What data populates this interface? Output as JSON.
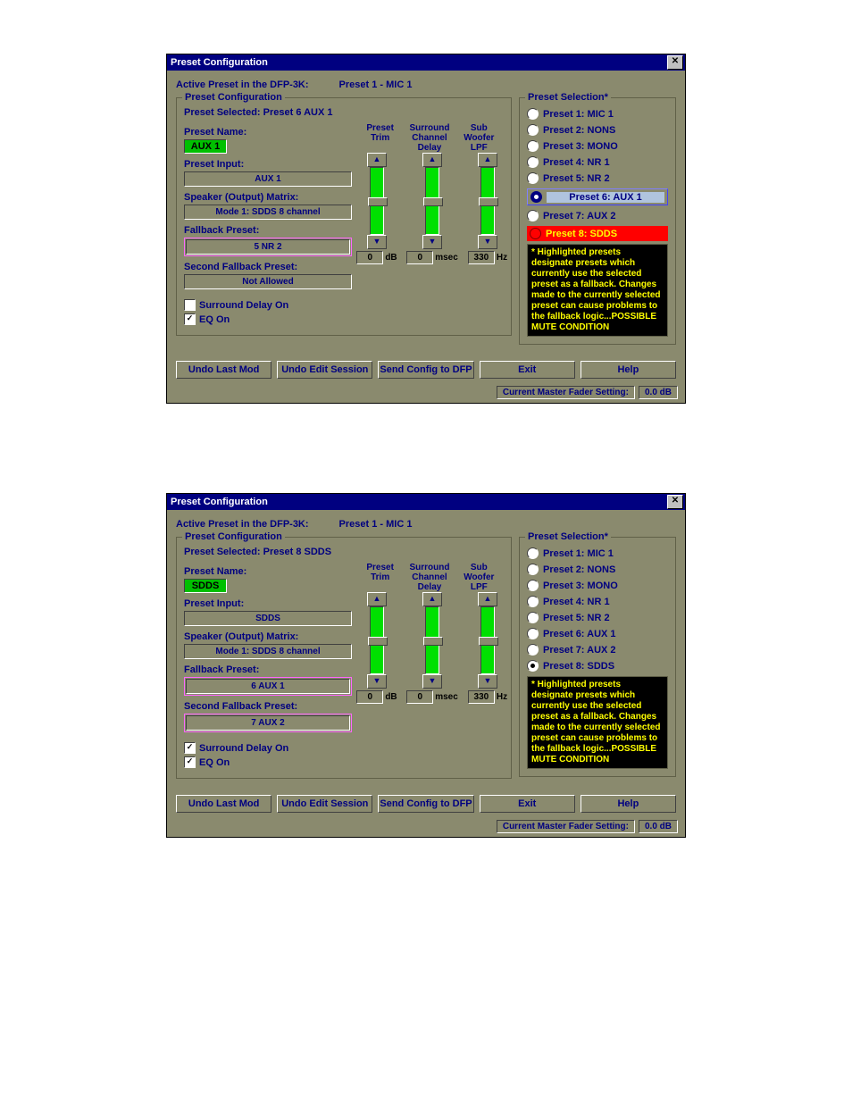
{
  "windows": [
    {
      "title": "Preset Configuration",
      "active_label": "Active Preset in the DFP-3K:",
      "active_value": "Preset 1 -  MIC 1",
      "config": {
        "legend": "Preset Configuration",
        "selected": "Preset Selected: Preset 6 AUX 1",
        "name_label": "Preset Name:",
        "name": "AUX 1",
        "input_label": "Preset Input:",
        "input": "AUX 1",
        "col_preset": "Preset",
        "col_trim": "Trim",
        "col_surr1": "Surround",
        "col_surr2": "Channel",
        "col_surr3": "Delay",
        "col_sub1": "Sub",
        "col_sub2": "Woofer",
        "col_sub3": "LPF",
        "matrix_label": "Speaker (Output) Matrix:",
        "matrix": "Mode 1: SDDS 8 channel",
        "fb_label": "Fallback  Preset:",
        "fb": "5  NR 2",
        "fb_hl": true,
        "fb2_label": "Second Fallback Preset:",
        "fb2": "Not Allowed",
        "fb2_hl": false,
        "chk1": "Surround Delay On",
        "chk1v": false,
        "chk2": "EQ On",
        "chk2v": true,
        "s1": {
          "val": "0",
          "unit": "dB",
          "arrow": "up",
          "thumb": "mid"
        },
        "s2": {
          "val": "0",
          "unit": "msec",
          "arrow": "up",
          "thumb": "mid"
        },
        "s3": {
          "val": "330",
          "unit": "Hz",
          "arrow": "up",
          "thumb": "mid"
        }
      },
      "selection": {
        "legend": "Preset Selection*",
        "items": [
          {
            "label": "Preset 1: MIC 1",
            "state": "n"
          },
          {
            "label": "Preset 2:   NONS",
            "state": "n"
          },
          {
            "label": "Preset 3:   MONO",
            "state": "n"
          },
          {
            "label": "Preset 4:   NR 1",
            "state": "n"
          },
          {
            "label": "Preset 5:   NR 2",
            "state": "n"
          },
          {
            "label": "Preset 6: AUX 1",
            "state": "hl"
          },
          {
            "label": "Preset 7:   AUX 2",
            "state": "n"
          },
          {
            "label": "Preset 8:   SDDS",
            "state": "alert"
          }
        ],
        "warn": "* Highlighted presets designate presets which currently use the selected preset as a fallback.  Changes made to the currently selected preset can cause problems to the fallback logic...POSSIBLE MUTE CONDITION"
      },
      "buttons": [
        "Undo Last Mod",
        "Undo Edit Session",
        "Send Config to DFP",
        "Exit",
        "Help"
      ],
      "status_label": "Current Master Fader Setting:",
      "status_value": "0.0   dB"
    },
    {
      "title": "Preset Configuration",
      "active_label": "Active Preset in the DFP-3K:",
      "active_value": "Preset 1 - MIC 1",
      "config": {
        "legend": "Preset Configuration",
        "selected": "Preset Selected: Preset 8 SDDS",
        "name_label": "Preset Name:",
        "name": "SDDS",
        "input_label": "Preset Input:",
        "input": "SDDS",
        "col_preset": "Preset",
        "col_trim": "Trim",
        "col_surr1": "Surround",
        "col_surr2": "Channel",
        "col_surr3": "Delay",
        "col_sub1": "Sub",
        "col_sub2": "Woofer",
        "col_sub3": "LPF",
        "matrix_label": "Speaker (Output) Matrix:",
        "matrix": "Mode 1: SDDS 8 channel",
        "fb_label": "Fallback  Preset:",
        "fb": "6 AUX 1",
        "fb_hl": true,
        "fb2_label": "Second Fallback Preset:",
        "fb2": "7   AUX 2",
        "fb2_hl": true,
        "chk1": "Surround Delay On",
        "chk1v": true,
        "chk2": "EQ On",
        "chk2v": true,
        "s1": {
          "val": "0",
          "unit": "dB",
          "arrow": "up",
          "thumb": "mid"
        },
        "s2": {
          "val": "0",
          "unit": "msec",
          "arrow": "up",
          "thumb": "mid"
        },
        "s3": {
          "val": "330",
          "unit": "Hz",
          "arrow": "up",
          "thumb": "mid"
        }
      },
      "selection": {
        "legend": "Preset Selection*",
        "items": [
          {
            "label": "Preset 1: MIC 1",
            "state": "n"
          },
          {
            "label": "Preset 2:   NONS",
            "state": "n"
          },
          {
            "label": "Preset 3:   MONO",
            "state": "n"
          },
          {
            "label": "Preset 4:   NR 1",
            "state": "n"
          },
          {
            "label": "Preset 5:   NR 2",
            "state": "n"
          },
          {
            "label": "Preset 6: AUX 1",
            "state": "n"
          },
          {
            "label": "Preset 7:   AUX 2",
            "state": "n"
          },
          {
            "label": "Preset 8: SDDS",
            "state": "sel"
          }
        ],
        "warn": "* Highlighted presets designate presets which currently use the selected preset as a fallback.  Changes made to the currently selected preset can cause problems to the fallback logic...POSSIBLE MUTE CONDITION"
      },
      "buttons": [
        "Undo Last Mod",
        "Undo Edit Session",
        "Send Config to DFP",
        "Exit",
        "Help"
      ],
      "status_label": "Current Master Fader Setting:",
      "status_value": "0.0   dB"
    }
  ]
}
